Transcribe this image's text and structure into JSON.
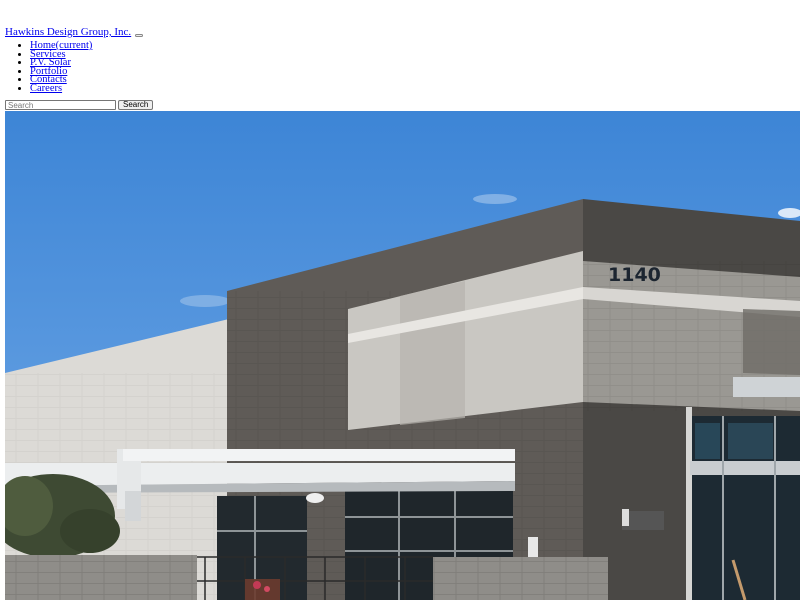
{
  "brand": {
    "name": "Hawkins Design Group, Inc."
  },
  "nav": {
    "items": [
      {
        "label": "Home(current)"
      },
      {
        "label": "Services"
      },
      {
        "label": "P.V. Solar"
      },
      {
        "label": "Portfolio"
      },
      {
        "label": "Contacts"
      },
      {
        "label": "Careers"
      }
    ]
  },
  "search": {
    "placeholder": "Search",
    "button_label": "Search"
  },
  "hero": {
    "building_number": "1140"
  }
}
